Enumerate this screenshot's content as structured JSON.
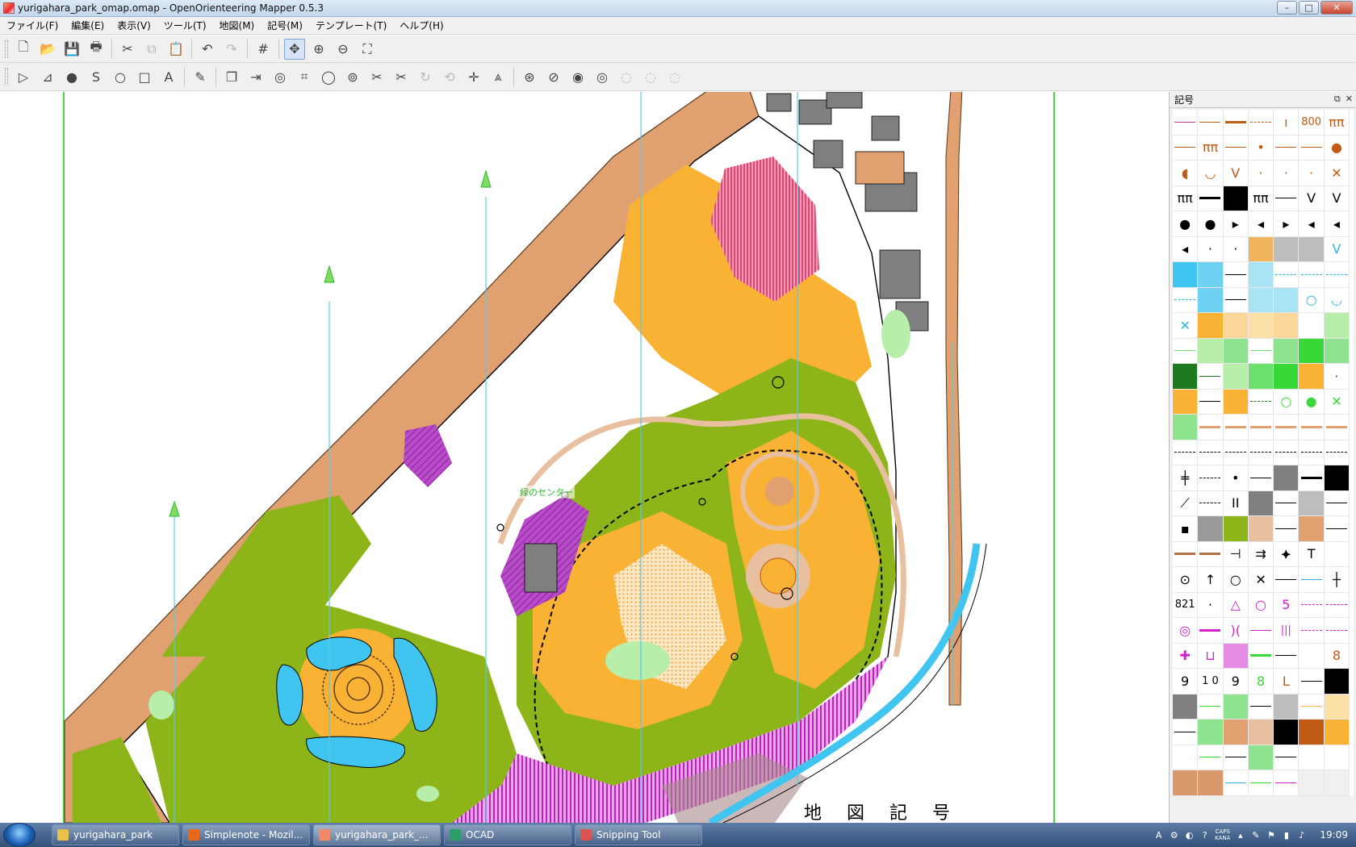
{
  "window": {
    "title": "yurigahara_park_omap.omap - OpenOrienteering Mapper 0.5.3",
    "controls": {
      "minimize": "–",
      "maximize": "□",
      "close": "✕"
    }
  },
  "menu": [
    {
      "label": "ファイル(F)"
    },
    {
      "label": "編集(E)"
    },
    {
      "label": "表示(V)"
    },
    {
      "label": "ツール(T)"
    },
    {
      "label": "地図(M)"
    },
    {
      "label": "記号(M)"
    },
    {
      "label": "テンプレート(T)"
    },
    {
      "label": "ヘルプ(H)"
    }
  ],
  "toolbar_top": [
    {
      "name": "new-file-icon",
      "glyph": "🗋"
    },
    {
      "name": "open-folder-icon",
      "glyph": "📂"
    },
    {
      "name": "save-icon",
      "glyph": "💾"
    },
    {
      "name": "print-icon",
      "glyph": "🖶"
    },
    {
      "name": "cut-icon",
      "glyph": "✂"
    },
    {
      "name": "copy-icon",
      "glyph": "⧉"
    },
    {
      "name": "paste-icon",
      "glyph": "📋"
    },
    {
      "name": "undo-icon",
      "glyph": "↶"
    },
    {
      "name": "redo-icon",
      "glyph": "↷"
    },
    {
      "name": "grid-icon",
      "glyph": "#"
    },
    {
      "name": "pan-icon",
      "glyph": "✥"
    },
    {
      "name": "zoom-in-icon",
      "glyph": "⊕"
    },
    {
      "name": "zoom-out-icon",
      "glyph": "⊖"
    },
    {
      "name": "fit-view-icon",
      "glyph": "⛶"
    }
  ],
  "toolbar_draw": [
    {
      "name": "edit-object-icon",
      "glyph": "▷"
    },
    {
      "name": "edit-line-icon",
      "glyph": "⊿"
    },
    {
      "name": "draw-point-icon",
      "glyph": "●"
    },
    {
      "name": "draw-path-icon",
      "glyph": "S"
    },
    {
      "name": "draw-circle-icon",
      "glyph": "○"
    },
    {
      "name": "draw-rectangle-icon",
      "glyph": "□"
    },
    {
      "name": "draw-text-icon",
      "glyph": "A"
    },
    {
      "name": "pencil-icon",
      "glyph": "✎"
    },
    {
      "name": "duplicate-icon",
      "glyph": "❐"
    },
    {
      "name": "switch-symbol-icon",
      "glyph": "⇥"
    },
    {
      "name": "fill-border-icon",
      "glyph": "◎"
    },
    {
      "name": "connect-paths-icon",
      "glyph": "⌗"
    },
    {
      "name": "boolean-icon",
      "glyph": "◯"
    },
    {
      "name": "union-icon",
      "glyph": "⊚"
    },
    {
      "name": "cut-object-icon",
      "glyph": "✂"
    },
    {
      "name": "cut-hole-icon",
      "glyph": "✂"
    },
    {
      "name": "rotate-icon",
      "glyph": "↻"
    },
    {
      "name": "rotate-pattern-icon",
      "glyph": "⟲"
    },
    {
      "name": "scale-icon",
      "glyph": "✛"
    },
    {
      "name": "measure-icon",
      "glyph": "⩓"
    },
    {
      "name": "area-union-icon",
      "glyph": "⊛"
    },
    {
      "name": "area-intersect-icon",
      "glyph": "⊘"
    },
    {
      "name": "area-difference-icon",
      "glyph": "◉"
    },
    {
      "name": "area-xor-icon",
      "glyph": "◎"
    },
    {
      "name": "area-merge-icon",
      "glyph": "◌"
    },
    {
      "name": "area-cut-icon",
      "glyph": "◌"
    },
    {
      "name": "area-convert-icon",
      "glyph": "◌"
    }
  ],
  "map": {
    "bottom_label": "地 図 記 号",
    "start_text": "緑のセンター"
  },
  "symbol_panel": {
    "title": "記号",
    "btn_float": "⧉",
    "btn_close": "✕",
    "cells": [
      {
        "k": "line",
        "c": "#c8328c"
      },
      {
        "k": "line",
        "c": "#c05a14"
      },
      {
        "k": "thick",
        "c": "#c05a14"
      },
      {
        "k": "dash",
        "c": "#c05a14"
      },
      {
        "k": "txt",
        "t": "ı",
        "c": "#c05a14"
      },
      {
        "k": "txt",
        "t": "800",
        "c": "#c05a14"
      },
      {
        "k": "txt",
        "t": "ππ",
        "c": "#c05a14"
      },
      {
        "k": "line",
        "c": "#c05a14"
      },
      {
        "k": "txt",
        "t": "ππ",
        "c": "#c05a14"
      },
      {
        "k": "line",
        "c": "#c05a14"
      },
      {
        "k": "txt",
        "t": "•",
        "c": "#c05a14"
      },
      {
        "k": "line",
        "c": "#c05a14"
      },
      {
        "k": "line",
        "c": "#c05a14"
      },
      {
        "k": "txt",
        "t": "●",
        "c": "#c05a14"
      },
      {
        "k": "txt",
        "t": "◖",
        "c": "#c05a14"
      },
      {
        "k": "txt",
        "t": "◡",
        "c": "#c05a14"
      },
      {
        "k": "txt",
        "t": "V",
        "c": "#c05a14"
      },
      {
        "k": "txt",
        "t": "·",
        "c": "#c05a14"
      },
      {
        "k": "txt",
        "t": "·",
        "c": "#c05a14"
      },
      {
        "k": "txt",
        "t": "·",
        "c": "#c05a14"
      },
      {
        "k": "txt",
        "t": "✕",
        "c": "#c05a14"
      },
      {
        "k": "txt",
        "t": "ππ",
        "c": "#000"
      },
      {
        "k": "thick",
        "c": "#000"
      },
      {
        "k": "fill",
        "c": "#000"
      },
      {
        "k": "txt",
        "t": "ππ",
        "c": "#000"
      },
      {
        "k": "line",
        "c": "#000"
      },
      {
        "k": "txt",
        "t": "V",
        "c": "#000"
      },
      {
        "k": "txt",
        "t": "V",
        "c": "#000"
      },
      {
        "k": "txt",
        "t": "●",
        "c": "#000"
      },
      {
        "k": "txt",
        "t": "●",
        "c": "#000"
      },
      {
        "k": "txt",
        "t": "▸",
        "c": "#000"
      },
      {
        "k": "txt",
        "t": "◂",
        "c": "#000"
      },
      {
        "k": "txt",
        "t": "▸",
        "c": "#000"
      },
      {
        "k": "txt",
        "t": "◂",
        "c": "#000"
      },
      {
        "k": "txt",
        "t": "◂",
        "c": "#000"
      },
      {
        "k": "txt",
        "t": "◂",
        "c": "#000"
      },
      {
        "k": "txt",
        "t": "·",
        "c": "#000"
      },
      {
        "k": "txt",
        "t": "·",
        "c": "#000"
      },
      {
        "k": "fill",
        "c": "#f2b45a"
      },
      {
        "k": "fill",
        "c": "#bdbdbd"
      },
      {
        "k": "fill",
        "c": "#bdbdbd"
      },
      {
        "k": "txt",
        "t": "V",
        "c": "#2eb6e8"
      },
      {
        "k": "fill",
        "c": "#40c4f0"
      },
      {
        "k": "fill",
        "c": "#70d2f2"
      },
      {
        "k": "line",
        "c": "#000"
      },
      {
        "k": "fill",
        "c": "#a8e4f6"
      },
      {
        "k": "dash",
        "c": "#2eb6e8"
      },
      {
        "k": "dash",
        "c": "#2eb6e8"
      },
      {
        "k": "dash",
        "c": "#2eb6e8"
      },
      {
        "k": "dash",
        "c": "#2eb6e8"
      },
      {
        "k": "fill",
        "c": "#70d2f2"
      },
      {
        "k": "line",
        "c": "#000"
      },
      {
        "k": "fill",
        "c": "#a8e4f6"
      },
      {
        "k": "fill",
        "c": "#a8e4f6"
      },
      {
        "k": "txt",
        "t": "○",
        "c": "#2eb6e8"
      },
      {
        "k": "txt",
        "t": "◡",
        "c": "#2eb6e8"
      },
      {
        "k": "txt",
        "t": "✕",
        "c": "#2eb6e8"
      },
      {
        "k": "fill",
        "c": "#f9b233"
      },
      {
        "k": "fill",
        "c": "#fcd79a"
      },
      {
        "k": "fill",
        "c": "#fde0a8"
      },
      {
        "k": "fill",
        "c": "#fcd79a"
      },
      {
        "k": "blank",
        "c": "#fff"
      },
      {
        "k": "fill",
        "c": "#b6eeaa"
      },
      {
        "k": "line",
        "c": "#6ce06c"
      },
      {
        "k": "fill",
        "c": "#b6eeaa"
      },
      {
        "k": "fill",
        "c": "#8fe38f"
      },
      {
        "k": "line",
        "c": "#6ce06c"
      },
      {
        "k": "fill",
        "c": "#8fe38f"
      },
      {
        "k": "fill",
        "c": "#38d838"
      },
      {
        "k": "fill",
        "c": "#8fe38f"
      },
      {
        "k": "fill",
        "c": "#1e7a1e"
      },
      {
        "k": "line",
        "c": "#1e7a1e"
      },
      {
        "k": "fill",
        "c": "#b6eeaa"
      },
      {
        "k": "fill",
        "c": "#6ce06c"
      },
      {
        "k": "fill",
        "c": "#38d838"
      },
      {
        "k": "fill",
        "c": "#f9b233"
      },
      {
        "k": "txt",
        "t": "·",
        "c": "#1e7a1e"
      },
      {
        "k": "fill",
        "c": "#f9b233"
      },
      {
        "k": "line",
        "c": "#000"
      },
      {
        "k": "fill",
        "c": "#f9b233"
      },
      {
        "k": "dash",
        "c": "#1e7a1e"
      },
      {
        "k": "txt",
        "t": "○",
        "c": "#38d838"
      },
      {
        "k": "txt",
        "t": "●",
        "c": "#38d838"
      },
      {
        "k": "txt",
        "t": "✕",
        "c": "#38d838"
      },
      {
        "k": "fill",
        "c": "#8fe38f"
      },
      {
        "k": "thick",
        "c": "#e0a070"
      },
      {
        "k": "thick",
        "c": "#e0a070"
      },
      {
        "k": "thick",
        "c": "#e0a070"
      },
      {
        "k": "thick",
        "c": "#e0a070"
      },
      {
        "k": "thick",
        "c": "#e0a070"
      },
      {
        "k": "thick",
        "c": "#e0a070"
      },
      {
        "k": "dash",
        "c": "#000"
      },
      {
        "k": "dash",
        "c": "#000"
      },
      {
        "k": "dash",
        "c": "#000"
      },
      {
        "k": "dash",
        "c": "#000"
      },
      {
        "k": "dash",
        "c": "#000"
      },
      {
        "k": "dash",
        "c": "#000"
      },
      {
        "k": "dash",
        "c": "#000"
      },
      {
        "k": "txt",
        "t": "╪",
        "c": "#000"
      },
      {
        "k": "dash",
        "c": "#000"
      },
      {
        "k": "txt",
        "t": "•",
        "c": "#000"
      },
      {
        "k": "line",
        "c": "#000"
      },
      {
        "k": "fill",
        "c": "#7f7f7f"
      },
      {
        "k": "thick",
        "c": "#000"
      },
      {
        "k": "fill",
        "c": "#000"
      },
      {
        "k": "txt",
        "t": "⟋",
        "c": "#000"
      },
      {
        "k": "dash",
        "c": "#000"
      },
      {
        "k": "txt",
        "t": "II",
        "c": "#000"
      },
      {
        "k": "fill",
        "c": "#7f7f7f"
      },
      {
        "k": "line",
        "c": "#000"
      },
      {
        "k": "fill",
        "c": "#bdbdbd"
      },
      {
        "k": "line",
        "c": "#000"
      },
      {
        "k": "txt",
        "t": "▪",
        "c": "#000"
      },
      {
        "k": "fill",
        "c": "#9a9a9a"
      },
      {
        "k": "fill",
        "c": "#8db51a"
      },
      {
        "k": "fill",
        "c": "#e8c0a0"
      },
      {
        "k": "line",
        "c": "#000"
      },
      {
        "k": "fill",
        "c": "#e0a070"
      },
      {
        "k": "line",
        "c": "#000"
      },
      {
        "k": "thick",
        "c": "#b07040"
      },
      {
        "k": "thick",
        "c": "#b07040"
      },
      {
        "k": "txt",
        "t": "⊣",
        "c": "#000"
      },
      {
        "k": "txt",
        "t": "⇉",
        "c": "#000"
      },
      {
        "k": "txt",
        "t": "⯌",
        "c": "#000"
      },
      {
        "k": "txt",
        "t": "T",
        "c": "#000"
      },
      {
        "k": "blank",
        "c": "#fff"
      },
      {
        "k": "txt",
        "t": "⊙",
        "c": "#000"
      },
      {
        "k": "txt",
        "t": "↑",
        "c": "#000"
      },
      {
        "k": "txt",
        "t": "○",
        "c": "#000"
      },
      {
        "k": "txt",
        "t": "✕",
        "c": "#000"
      },
      {
        "k": "line",
        "c": "#000"
      },
      {
        "k": "line",
        "c": "#2eb6e8"
      },
      {
        "k": "txt",
        "t": "┼",
        "c": "#000"
      },
      {
        "k": "txt",
        "t": "821",
        "c": "#000"
      },
      {
        "k": "txt",
        "t": "·",
        "c": "#000"
      },
      {
        "k": "txt",
        "t": "△",
        "c": "#d321d3"
      },
      {
        "k": "txt",
        "t": "○",
        "c": "#d321d3"
      },
      {
        "k": "txt",
        "t": "5",
        "c": "#d321d3"
      },
      {
        "k": "dash",
        "c": "#d321d3"
      },
      {
        "k": "dash",
        "c": "#d321d3"
      },
      {
        "k": "txt",
        "t": "◎",
        "c": "#d321d3"
      },
      {
        "k": "thick",
        "c": "#d321d3"
      },
      {
        "k": "txt",
        "t": ")(",
        "c": "#d321d3"
      },
      {
        "k": "line",
        "c": "#d321d3"
      },
      {
        "k": "txt",
        "t": "|||",
        "c": "#d321d3"
      },
      {
        "k": "dash",
        "c": "#d321d3"
      },
      {
        "k": "dash",
        "c": "#d321d3"
      },
      {
        "k": "txt",
        "t": "✚",
        "c": "#d321d3"
      },
      {
        "k": "txt",
        "t": "⊔",
        "c": "#d321d3"
      },
      {
        "k": "fill",
        "c": "#e58ae5"
      },
      {
        "k": "thick",
        "c": "#38d838"
      },
      {
        "k": "line",
        "c": "#000"
      },
      {
        "k": "blank",
        "c": "#fff"
      },
      {
        "k": "txt",
        "t": "8",
        "c": "#c05a14"
      },
      {
        "k": "txt",
        "t": "9",
        "c": "#000"
      },
      {
        "k": "txt",
        "t": "1 0",
        "c": "#000"
      },
      {
        "k": "txt",
        "t": "9",
        "c": "#000"
      },
      {
        "k": "txt",
        "t": "8",
        "c": "#38d838"
      },
      {
        "k": "txt",
        "t": "L",
        "c": "#c05a14"
      },
      {
        "k": "line",
        "c": "#000"
      },
      {
        "k": "fill",
        "c": "#000"
      },
      {
        "k": "fill",
        "c": "#7f7f7f"
      },
      {
        "k": "line",
        "c": "#38d838"
      },
      {
        "k": "fill",
        "c": "#8fe38f"
      },
      {
        "k": "line",
        "c": "#000"
      },
      {
        "k": "fill",
        "c": "#bdbdbd"
      },
      {
        "k": "line",
        "c": "#f9b233"
      },
      {
        "k": "fill",
        "c": "#fde0a8"
      },
      {
        "k": "line",
        "c": "#000"
      },
      {
        "k": "fill",
        "c": "#8fe38f"
      },
      {
        "k": "fill",
        "c": "#e0a070"
      },
      {
        "k": "fill",
        "c": "#e8c0a0"
      },
      {
        "k": "fill",
        "c": "#000"
      },
      {
        "k": "fill",
        "c": "#c05a14"
      },
      {
        "k": "fill",
        "c": "#f9b233"
      },
      {
        "k": "blank",
        "c": "#fff"
      },
      {
        "k": "line",
        "c": "#38d838"
      },
      {
        "k": "line",
        "c": "#000"
      },
      {
        "k": "fill",
        "c": "#8fe38f"
      },
      {
        "k": "line",
        "c": "#000"
      },
      {
        "k": "blank",
        "c": "#fff"
      },
      {
        "k": "blank",
        "c": "#fff"
      },
      {
        "k": "fill",
        "c": "#d89a6a"
      },
      {
        "k": "fill",
        "c": "#d89a6a"
      },
      {
        "k": "line",
        "c": "#2eb6e8"
      },
      {
        "k": "line",
        "c": "#38d838"
      },
      {
        "k": "line",
        "c": "#d321d3"
      },
      {
        "k": "blank",
        "c": "#f0f0f0"
      },
      {
        "k": "blank",
        "c": "#f0f0f0"
      }
    ]
  },
  "taskbar": {
    "items": [
      {
        "label": "yurigahara_park",
        "icon": "folder-icon",
        "color": "#e8c04a"
      },
      {
        "label": "Simplenote - Mozil...",
        "icon": "firefox-icon",
        "color": "#e86a1a"
      },
      {
        "label": "yurigahara_park_...",
        "icon": "mapper-icon",
        "color": "#f28a6a",
        "active": true
      },
      {
        "label": "OCAD",
        "icon": "ocad-icon",
        "color": "#2b9e6a"
      },
      {
        "label": "Snipping Tool",
        "icon": "snipping-icon",
        "color": "#d9534f"
      }
    ],
    "tray": {
      "ime": "A",
      "caps_top": "CAPS",
      "caps_bottom": "KANA",
      "time": "19:09"
    }
  },
  "colors": {
    "forest_green": "#8db51a",
    "open_yellow": "#f9b233",
    "paved_brown": "#e0a070",
    "oob_magenta": "#c200c2",
    "water_blue": "#40c4f0",
    "grid_blue": "#5bc8e8",
    "frame_green": "#4cd64c"
  }
}
